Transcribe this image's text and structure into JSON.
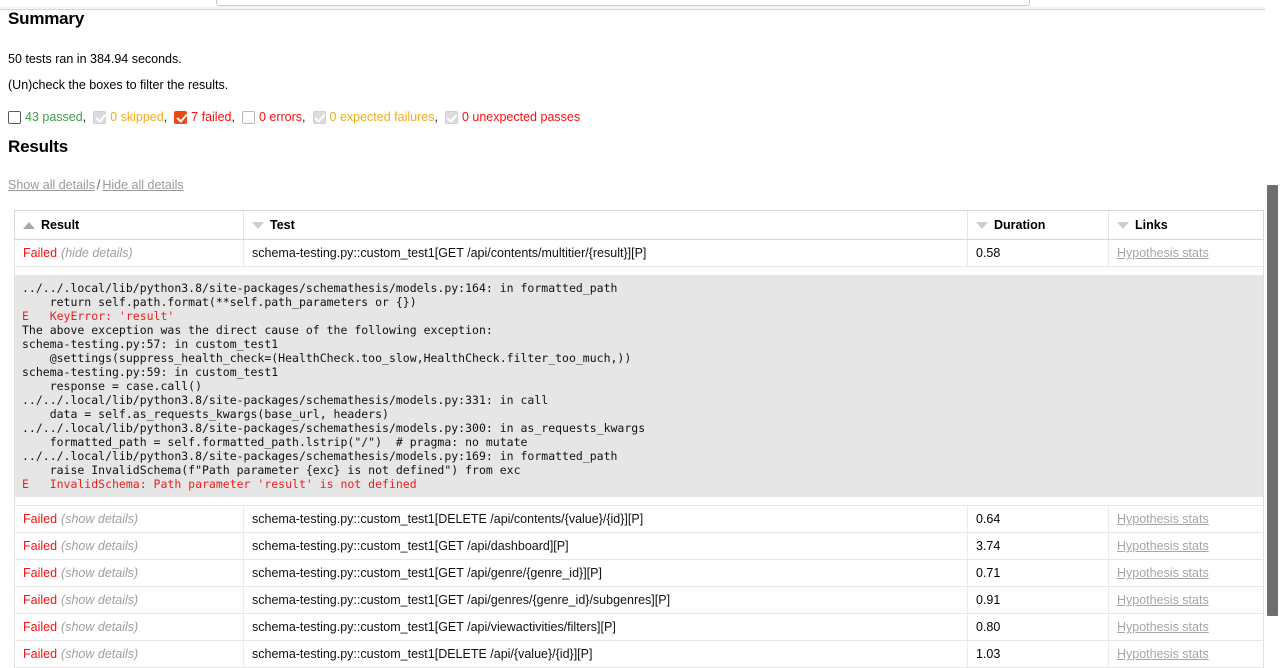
{
  "summary": {
    "heading": "Summary",
    "run_line": "50 tests ran in 384.94 seconds.",
    "filter_hint": "(Un)check the boxes to filter the results."
  },
  "filters": [
    {
      "label": "43 passed",
      "state": "unchecked-dark",
      "color_class": "cb-label-green",
      "separator": ","
    },
    {
      "label": "0 skipped",
      "state": "checked-gray",
      "color_class": "cb-label-orange",
      "separator": ","
    },
    {
      "label": "7 failed",
      "state": "checked-accent",
      "color_class": "cb-label-red",
      "separator": ","
    },
    {
      "label": "0 errors",
      "state": "unchecked-light",
      "color_class": "cb-label-red",
      "separator": ","
    },
    {
      "label": "0 expected failures",
      "state": "checked-gray",
      "color_class": "cb-label-orange",
      "separator": ","
    },
    {
      "label": "0 unexpected passes",
      "state": "checked-gray",
      "color_class": "cb-label-red",
      "separator": ""
    }
  ],
  "results": {
    "heading": "Results",
    "show_all_label": "Show all details",
    "slash": "/",
    "hide_all_label": "Hide all details",
    "columns": [
      {
        "label": "Result",
        "sort": "asc"
      },
      {
        "label": "Test",
        "sort": "desc"
      },
      {
        "label": "Duration",
        "sort": "desc"
      },
      {
        "label": "Links",
        "sort": "desc"
      }
    ],
    "rows": [
      {
        "status": "Failed",
        "toggle": "(hide details)",
        "test": "schema-testing.py::custom_test1[GET /api/contents/multitier/{result}][P]",
        "duration": "0.58",
        "link": "Hypothesis stats",
        "expanded": true
      },
      {
        "status": "Failed",
        "toggle": "(show details)",
        "test": "schema-testing.py::custom_test1[DELETE /api/contents/{value}/{id}][P]",
        "duration": "0.64",
        "link": "Hypothesis stats",
        "expanded": false
      },
      {
        "status": "Failed",
        "toggle": "(show details)",
        "test": "schema-testing.py::custom_test1[GET /api/dashboard][P]",
        "duration": "3.74",
        "link": "Hypothesis stats",
        "expanded": false
      },
      {
        "status": "Failed",
        "toggle": "(show details)",
        "test": "schema-testing.py::custom_test1[GET /api/genre/{genre_id}][P]",
        "duration": "0.71",
        "link": "Hypothesis stats",
        "expanded": false
      },
      {
        "status": "Failed",
        "toggle": "(show details)",
        "test": "schema-testing.py::custom_test1[GET /api/genres/{genre_id}/subgenres][P]",
        "duration": "0.91",
        "link": "Hypothesis stats",
        "expanded": false
      },
      {
        "status": "Failed",
        "toggle": "(show details)",
        "test": "schema-testing.py::custom_test1[GET /api/viewactivities/filters][P]",
        "duration": "0.80",
        "link": "Hypothesis stats",
        "expanded": false
      },
      {
        "status": "Failed",
        "toggle": "(show details)",
        "test": "schema-testing.py::custom_test1[DELETE /api/{value}/{id}][P]",
        "duration": "1.03",
        "link": "Hypothesis stats",
        "expanded": false
      }
    ],
    "traceback": {
      "lines": [
        {
          "text": "../../.local/lib/python3.8/site-packages/schemathesis/models.py:164: in formatted_path",
          "error": false
        },
        {
          "text": "    return self.path.format(**self.path_parameters or {})",
          "error": false
        },
        {
          "text": "E   KeyError: 'result'",
          "error": true
        },
        {
          "text": "",
          "error": false
        },
        {
          "text": "The above exception was the direct cause of the following exception:",
          "error": false
        },
        {
          "text": "schema-testing.py:57: in custom_test1",
          "error": false
        },
        {
          "text": "    @settings(suppress_health_check=(HealthCheck.too_slow,HealthCheck.filter_too_much,))",
          "error": false
        },
        {
          "text": "schema-testing.py:59: in custom_test1",
          "error": false
        },
        {
          "text": "    response = case.call()",
          "error": false
        },
        {
          "text": "../../.local/lib/python3.8/site-packages/schemathesis/models.py:331: in call",
          "error": false
        },
        {
          "text": "    data = self.as_requests_kwargs(base_url, headers)",
          "error": false
        },
        {
          "text": "../../.local/lib/python3.8/site-packages/schemathesis/models.py:300: in as_requests_kwargs",
          "error": false
        },
        {
          "text": "    formatted_path = self.formatted_path.lstrip(\"/\")  # pragma: no mutate",
          "error": false
        },
        {
          "text": "../../.local/lib/python3.8/site-packages/schemathesis/models.py:169: in formatted_path",
          "error": false
        },
        {
          "text": "    raise InvalidSchema(f\"Path parameter {exc} is not defined\") from exc",
          "error": false
        },
        {
          "text": "E   InvalidSchema: Path parameter 'result' is not defined",
          "error": true
        }
      ]
    }
  },
  "colors": {
    "accent_checked": "#ec4a10",
    "failed_red": "#ff0f0f",
    "passed_green": "#43a047",
    "skipped_orange": "#f0ad1f",
    "traceback_bg": "#e6e6e6",
    "link_gray": "#a6a6a6"
  }
}
